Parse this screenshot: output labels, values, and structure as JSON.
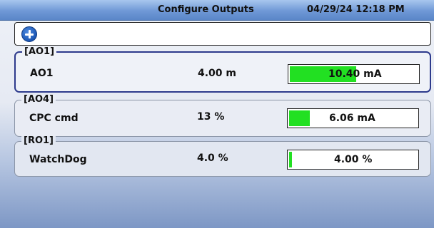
{
  "header": {
    "title": "Configure Outputs",
    "datetime": "04/29/24 12:18 PM"
  },
  "add_button": {
    "icon": "add-circle-icon"
  },
  "outputs": [
    {
      "group": "[AO1]",
      "name": "AO1",
      "value": "4.00 m",
      "meter_text": "10.40 mA",
      "fill_fraction": 0.52,
      "selected": true
    },
    {
      "group": "[AO4]",
      "name": "CPC cmd",
      "value": "13 %",
      "meter_text": "6.06 mA",
      "fill_fraction": 0.16,
      "selected": false
    },
    {
      "group": "[RO1]",
      "name": "WatchDog",
      "value": "4.0 %",
      "meter_text": "4.00 %",
      "fill_fraction": 0.02,
      "selected": false
    }
  ],
  "colors": {
    "meter_fill": "#22e022",
    "selected_border": "#2d3a8c",
    "header": "#6f98d6"
  }
}
